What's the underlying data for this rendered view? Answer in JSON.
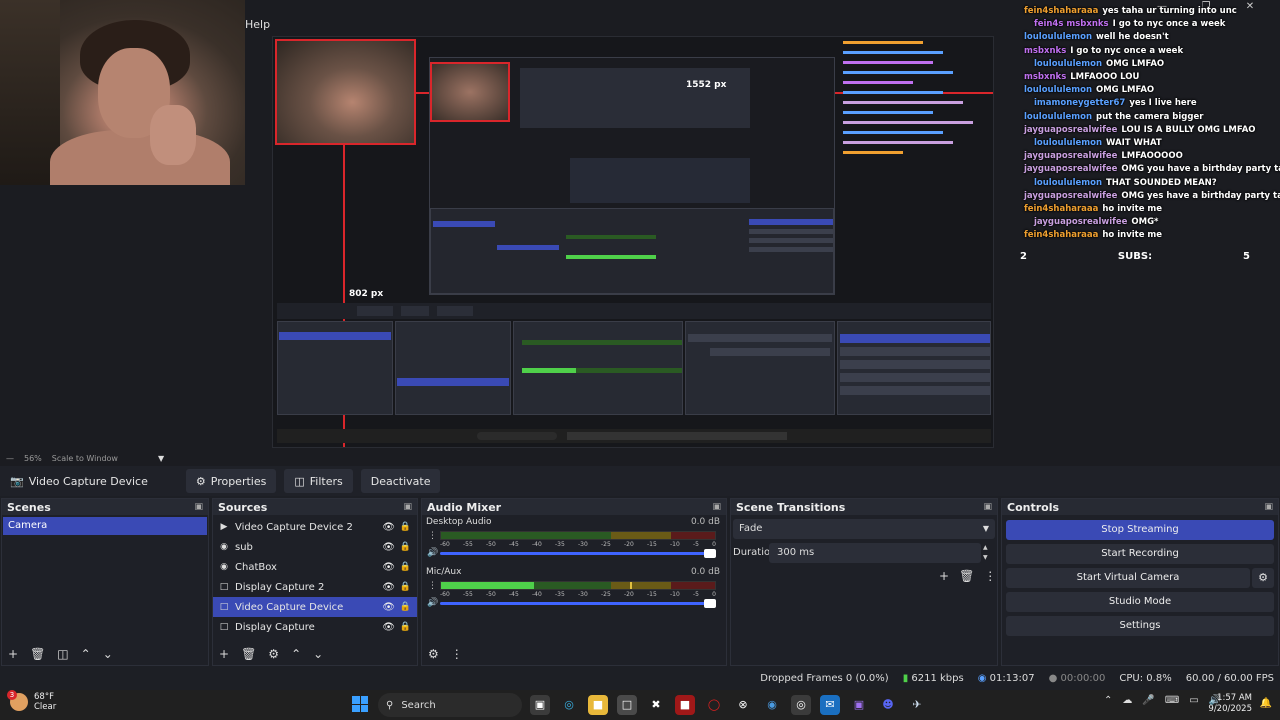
{
  "menubar": {
    "help": "Help"
  },
  "preview": {
    "px_label_1": "1552 px",
    "px_label_2": "802 px"
  },
  "chat": {
    "lines": [
      {
        "user": "fein4shaharaaa",
        "text": "yes taha ur turning into unc",
        "color": "#f0a030"
      },
      {
        "user": "fein4s msbxnks",
        "text": "I go to nyc once a week",
        "color": "#c070f0"
      },
      {
        "user": "louloululemon",
        "text": "well he doesn't",
        "color": "#5aa0ff"
      },
      {
        "user": "msbxnks",
        "text": "I go to nyc once a week",
        "color": "#c070f0"
      },
      {
        "user": "louloululemon",
        "text": "OMG LMFAO",
        "color": "#5aa0ff"
      },
      {
        "user": "msbxnks",
        "text": "LMFAOOO LOU",
        "color": "#c070f0"
      },
      {
        "user": "louloululemon",
        "text": "OMG LMFAO",
        "color": "#5aa0ff"
      },
      {
        "user": "imamoneygetter67",
        "text": "yes I live here",
        "color": "#5aa0ff"
      },
      {
        "user": "louloululemon",
        "text": "put the camera bigger",
        "color": "#5aa0ff"
      },
      {
        "user": "jayguaposrealwifee",
        "text": "LOU IS A BULLY OMG LMFAO",
        "color": "#c9a0e0"
      },
      {
        "user": "louloululemon",
        "text": "WAIT WHAT",
        "color": "#5aa0ff"
      },
      {
        "user": "jayguaposrealwifee",
        "text": "LMFAOOOOO",
        "color": "#c9a0e0"
      },
      {
        "user": "jayguaposrealwifee",
        "text": "OMG you have a birthday party taha",
        "color": "#c9a0e0"
      },
      {
        "user": "louloululemon",
        "text": "THAT SOUNDED MEAN?",
        "color": "#5aa0ff"
      },
      {
        "user": "jayguaposrealwifee",
        "text": "OMG yes have a birthday party taha",
        "color": "#c9a0e0"
      },
      {
        "user": "fein4shaharaaa",
        "text": "ho invite me",
        "color": "#f0a030"
      },
      {
        "user": "jayguaposrealwifee",
        "text": "OMG*",
        "color": "#c9a0e0"
      },
      {
        "user": "fein4shaharaaa",
        "text": "ho invite me",
        "color": "#f0a030"
      }
    ],
    "subs_left": "2",
    "subs_label": "SUBS:",
    "subs_right": "5"
  },
  "zoombar": {
    "zoom": "56%",
    "mode": "Scale to Window"
  },
  "toolbar": {
    "source": "Video Capture Device",
    "properties": "Properties",
    "filters": "Filters",
    "deactivate": "Deactivate"
  },
  "scenes": {
    "title": "Scenes",
    "items": [
      "Camera"
    ]
  },
  "sources": {
    "title": "Sources",
    "items": [
      {
        "label": "Video Capture Device 2",
        "icon": "camera-icon"
      },
      {
        "label": "sub",
        "icon": "globe-icon"
      },
      {
        "label": "ChatBox",
        "icon": "globe-icon"
      },
      {
        "label": "Display Capture 2",
        "icon": "monitor-icon"
      },
      {
        "label": "Video Capture Device",
        "icon": "camera-icon"
      },
      {
        "label": "Display Capture",
        "icon": "monitor-icon"
      }
    ]
  },
  "mixer": {
    "title": "Audio Mixer",
    "channels": [
      {
        "name": "Desktop Audio",
        "db": "0.0 dB",
        "level": 0.0,
        "peak": 0.0
      },
      {
        "name": "Mic/Aux",
        "db": "0.0 dB",
        "level": 0.34,
        "peak": 0.69
      }
    ],
    "ticks": [
      "-60",
      "-55",
      "-50",
      "-45",
      "-40",
      "-35",
      "-30",
      "-25",
      "-20",
      "-15",
      "-10",
      "-5",
      "0"
    ]
  },
  "transitions": {
    "title": "Scene Transitions",
    "selected": "Fade",
    "duration_label": "Duration",
    "duration": "300 ms"
  },
  "controls": {
    "title": "Controls",
    "stop_streaming": "Stop Streaming",
    "start_recording": "Start Recording",
    "start_virtual_camera": "Start Virtual Camera",
    "studio_mode": "Studio Mode",
    "settings": "Settings"
  },
  "status": {
    "dropped": "Dropped Frames 0 (0.0%)",
    "kbps": "6211 kbps",
    "stream_time": "01:13:07",
    "rec_time": "00:00:00",
    "cpu": "CPU: 0.8%",
    "fps": "60.00 / 60.00 FPS"
  },
  "taskbar": {
    "temp": "68°F",
    "condition": "Clear",
    "search": "Search",
    "time": "1:57 AM",
    "date": "9/20/2025"
  },
  "colors": {
    "accent": "#3a4ab5",
    "red": "#d9262b",
    "green": "#4fd04a"
  }
}
